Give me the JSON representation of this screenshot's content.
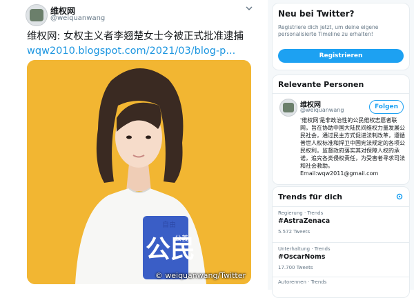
{
  "tweet": {
    "author_name": "维权网",
    "author_handle": "@weiquanwang",
    "text": "维权网: 女权主义者李翘楚女士今被正式批准逮捕",
    "link": "wqw2010.blogspot.com/2021/03/blog-p...",
    "photo_credit": "© weiquanwang/Twitter",
    "shirt_text_1": "自由",
    "shirt_text_2": "公義",
    "shirt_big": "公民"
  },
  "sidebar": {
    "new_title": "Neu bei Twitter?",
    "new_desc": "Registriere dich jetzt, um deine eigene personalisierte Timeline zu erhalten!",
    "register_label": "Registrieren",
    "people_title": "Relevante Personen",
    "person_name": "维权网",
    "person_handle": "@weiquanwang",
    "follow_label": "Folgen",
    "person_bio": "'维权网'是非政治性的公民维权志愿者联网，旨在协助中国大陆民间维权力量发展公民社会，通过民主方式促进法制改革，遵循普世人权标准和捍卫中国宪法规定的各项公民权利，监督政府落实其对保障人权的承诺，追究各类侵权责任，为受害者寻求司法和社会救助。Email:wqw2011@gmail.com",
    "trends_title": "Trends für dich",
    "trends": [
      {
        "meta": "Regierung · Trends",
        "tag": "#AstraZenaca",
        "count": "5.572 Tweets"
      },
      {
        "meta": "Unterhaltung · Trends",
        "tag": "#OscarNoms",
        "count": "17.700 Tweets"
      },
      {
        "meta": "Autorennen · Trends",
        "tag": "",
        "count": ""
      }
    ]
  },
  "colors": {
    "accent": "#1da1f2",
    "link": "#1b95e0",
    "photo_bg": "#f2b632"
  }
}
